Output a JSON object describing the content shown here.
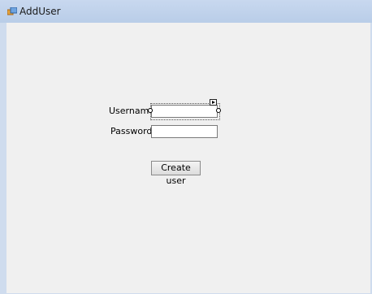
{
  "window": {
    "title": "AddUser"
  },
  "form": {
    "username_label": "Username",
    "password_label": "Password",
    "username_value": "",
    "password_value": "",
    "create_button_label": "Create user"
  }
}
